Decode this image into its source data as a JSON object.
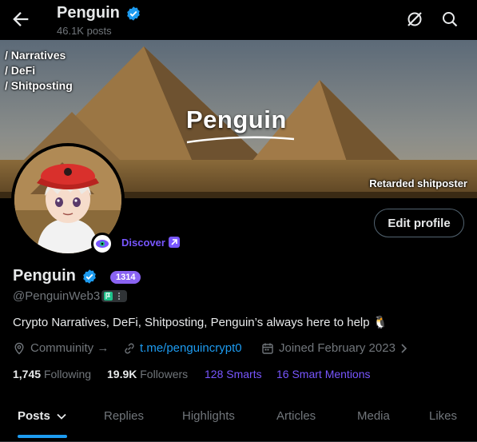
{
  "header": {
    "title": "Penguin",
    "post_count": "46.1K posts",
    "icons": [
      "back-arrow-icon",
      "grok-icon",
      "search-icon"
    ]
  },
  "banner": {
    "tags": [
      "/ Narratives",
      "/ DeFi",
      "/ Shitposting"
    ],
    "title": "Penguin",
    "footer": "Retarded shitposter"
  },
  "profile": {
    "discover_label": "Discover",
    "edit_button": "Edit profile",
    "name": "Penguin",
    "score": "1314",
    "handle": "@PenguinWeb3",
    "bio": "Crypto Narratives, DeFi, Shitposting, Penguin’s always here to help 🐧",
    "community": "Commuinity →",
    "link": "t.me/penguincrypt0",
    "joined": "Joined February 2023",
    "following_count": "1,745",
    "following_label": "Following",
    "followers_count": "19.9K",
    "followers_label": "Followers",
    "smarts": "128 Smarts",
    "smart_mentions": "16 Smart Mentions"
  },
  "tabs": [
    "Posts",
    "Replies",
    "Highlights",
    "Articles",
    "Media",
    "Likes"
  ],
  "colors": {
    "accent_blue": "#1d9bf0",
    "accent_purple": "#7856ff",
    "background": "#000000",
    "muted_text": "#71767b"
  }
}
